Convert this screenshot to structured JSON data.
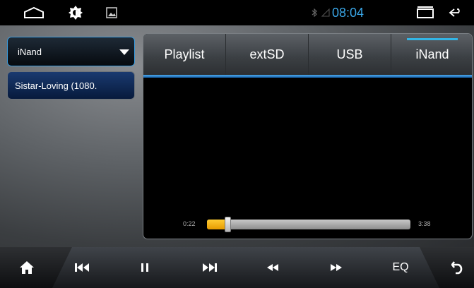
{
  "status_bar": {
    "time": "08:04",
    "icons": [
      "home-icon",
      "brightness-icon",
      "image-icon",
      "bluetooth-icon",
      "signal-icon",
      "recent-apps-icon",
      "back-icon"
    ]
  },
  "source_select": {
    "value": "iNand"
  },
  "file_list": [
    {
      "name": "Sistar-Loving (1080."
    }
  ],
  "tabs": [
    {
      "label": "Playlist",
      "active": false
    },
    {
      "label": "extSD",
      "active": false
    },
    {
      "label": "USB",
      "active": false
    },
    {
      "label": "iNand",
      "active": true
    }
  ],
  "playback": {
    "current_time": "0:22",
    "total_time": "3:38",
    "progress": 0.1
  },
  "controls": {
    "eq_label": "EQ",
    "icons": [
      "home-icon",
      "previous-icon",
      "pause-icon",
      "next-icon",
      "rewind-icon",
      "fast-forward-icon",
      "return-icon"
    ]
  },
  "colors": {
    "accent": "#33b5e5",
    "seek_fill": "#f5b316",
    "file_item_bg": "#0d2a5c"
  }
}
